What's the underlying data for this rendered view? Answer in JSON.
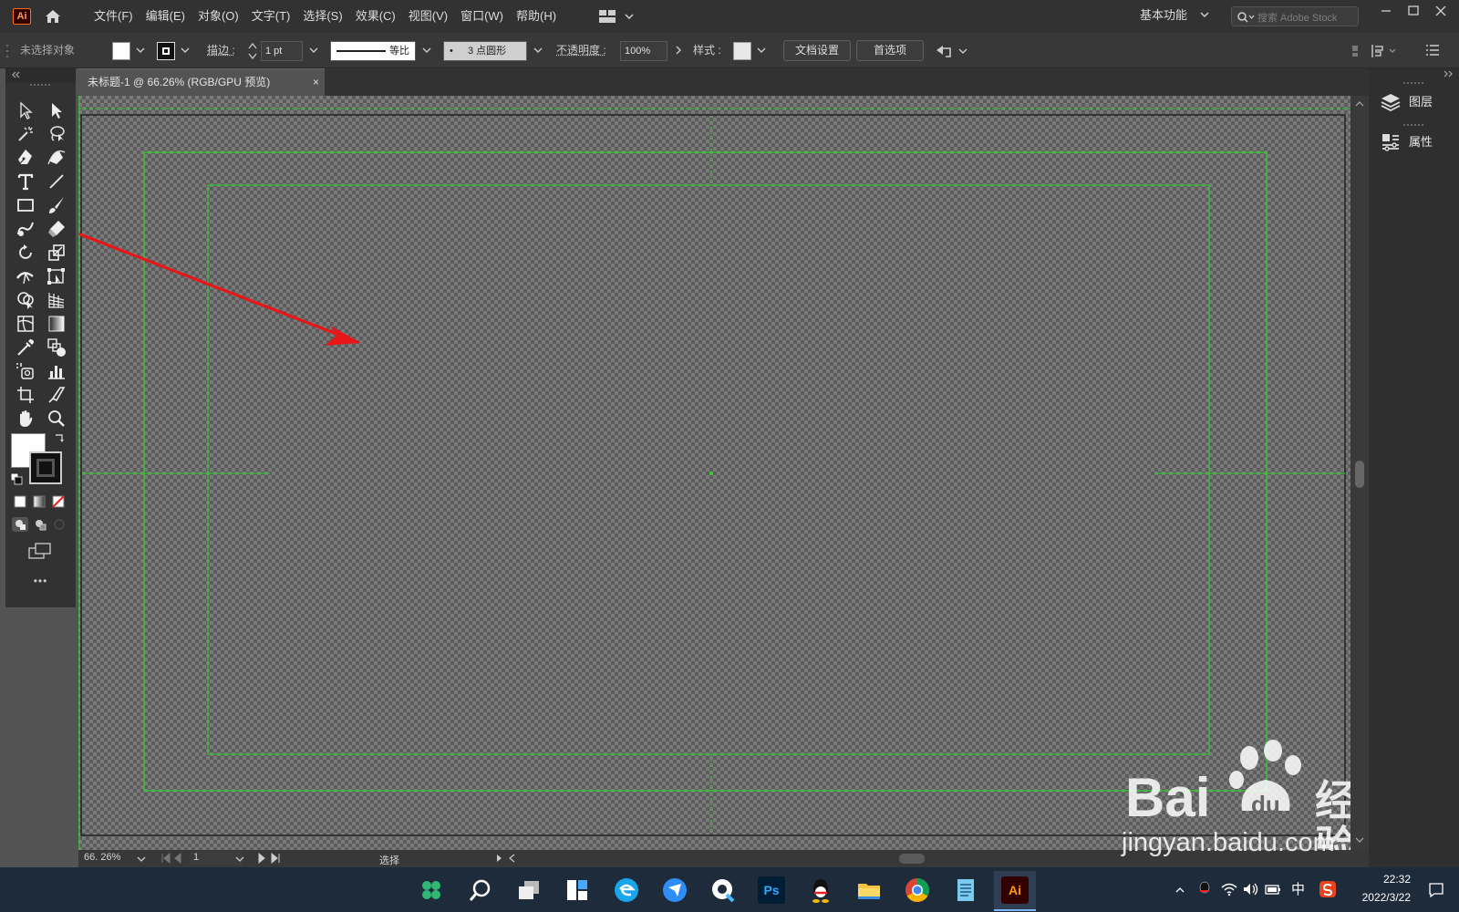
{
  "app": {
    "logo": "Ai"
  },
  "menu": [
    "文件(F)",
    "编辑(E)",
    "对象(O)",
    "文字(T)",
    "选择(S)",
    "效果(C)",
    "视图(V)",
    "窗口(W)",
    "帮助(H)"
  ],
  "workspace": {
    "label": "基本功能"
  },
  "stock": {
    "placeholder": "搜索 Adobe Stock"
  },
  "control": {
    "selection": "未选择对象",
    "stroke_label": "描边 :",
    "stroke_value": "1 pt",
    "profile": "等比",
    "brush_dot": "•",
    "brush": "3 点圆形",
    "opacity_label": "不透明度 :",
    "opacity_value": "100%",
    "style_label": "样式 :",
    "doc_setup": "文档设置",
    "prefs": "首选项"
  },
  "document_tab": {
    "title": "未标题-1 @ 66.26% (RGB/GPU 预览)",
    "close": "×"
  },
  "toolbar": {
    "more": "•••"
  },
  "panels": [
    {
      "name": "layers",
      "label": "图层",
      "icon": "layers-icon"
    },
    {
      "name": "properties",
      "label": "属性",
      "icon": "properties-icon"
    }
  ],
  "status": {
    "zoom": "66. 26%",
    "artboard": "1",
    "mode": "选择"
  },
  "taskbar": {
    "icons": [
      "app-grid-icon",
      "search-icon",
      "task-view-icon",
      "widgets-icon",
      "edge-icon",
      "feishu-icon",
      "browser-icon",
      "photoshop-icon",
      "qq-icon",
      "explorer-icon",
      "chrome-icon",
      "notepad-icon",
      "illustrator-icon"
    ],
    "ps_label": "Ps",
    "ai_label": "Ai",
    "ime": "中",
    "time": "22:32",
    "date": "2022/3/22"
  },
  "watermark": {
    "main": "Bai",
    "paw": "du",
    "cn": "经验",
    "url": "jingyan.baidu.com"
  },
  "colors": {
    "guide": "#2ed32e",
    "arrow": "#e81717",
    "accent": "#ff6a1f"
  }
}
